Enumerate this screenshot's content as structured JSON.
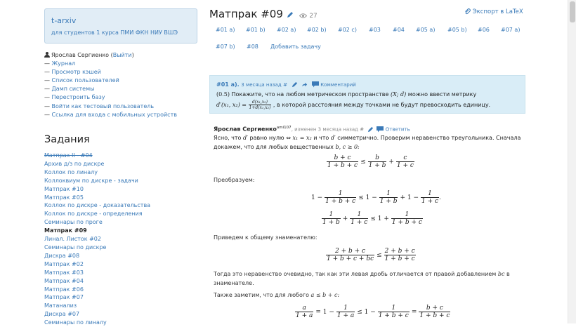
{
  "brand": {
    "title": "t-arxiv",
    "subtitle": "для студентов 1 курса ПМИ ФКН НИУ ВШЭ"
  },
  "user": {
    "name": "Ярослав Сергиенко",
    "logout_prefix": " (",
    "logout": "Выйти",
    "logout_suffix": ")"
  },
  "user_links": [
    "Журнал",
    "Просмотр кэшей",
    "Список пользователей",
    "Дамп системы",
    "Перестроить базу",
    "Войти как тестовый пользователь",
    "Ссылка для входа с мобильных устройств"
  ],
  "tasks_heading": "Задания",
  "tasks": [
    "Матпрак II - #04",
    "Архив д/з по дискре",
    "Коллок по линалу",
    "Коллоквиум по дискре - задачи",
    "Матпрак #10",
    "Матпрак #05",
    "Коллок по дискре - доказательства",
    "Коллок по дискре - определения",
    "Семинары по проге",
    "Матпрак #09",
    "Линал. Листок #02",
    "Семинары по дискре",
    "Дискра #08",
    "Матпрак #02",
    "Матпрак #03",
    "Матпрак #04",
    "Матпрак #06",
    "Матпрак #07",
    "Матанализ",
    "Дискра #07",
    "Семинары по линалу"
  ],
  "page": {
    "title": "Матпрак #09",
    "views": "27",
    "export": "Экспорт в LaTeX"
  },
  "subnav": [
    "#01 a)",
    "#01 b)",
    "#02 a)",
    "#02 b)",
    "#02 c)",
    "#03",
    "#04",
    "#05 a)",
    "#05 b)",
    "#06",
    "#07 a)",
    "#07 b)",
    "#08",
    "Добавить задачу"
  ],
  "problem": {
    "label": "#01 a).",
    "when": "3 месяца назад",
    "hash": "#",
    "comment": "Комментарий",
    "points": "(0.5)",
    "text1": "Покажите, что на любом метрическом пространстве",
    "space": "(X; d)",
    "text2": "можно ввести метрику",
    "metric_lhs": "d′(x₁, x₂) =",
    "metric_num": "d(x₁,x₂)",
    "metric_den": "1+d(x₁,x₂)",
    "text3": ", в которой расстояния между точками не будут превосходить единицу."
  },
  "solution": {
    "author": "Ярослав Сергиенко",
    "author_sup": "ami107",
    "edited": ", изменен 3 месяца назад #",
    "reply": "Ответить",
    "p1a": "Ясно, что",
    "p1b": "равно нулю ⇔",
    "p1c": "и что",
    "p1d": "симметрично. Проверим неравенство треугольника. Сначала",
    "p1e": "докажем, что для любых вещественных",
    "p2": "Преобразуем:",
    "p3": "Приведем к общему знаменателю:",
    "p4a": "Тогда это неравенство очевидно, так как эти левая дробь отличается от правой добавлением",
    "p4b": "в",
    "p4c": "знаменателе.",
    "p5": "Также заметим, что для любого"
  },
  "math": {
    "dprime": "d′",
    "x1eqx2": "x₁ = x₂",
    "bc_ge0": "b, c ≥ 0:",
    "bc": "bc",
    "a_le": "a ≤ b + c:",
    "f1": [
      "b + c",
      "1 + b + c",
      "≤",
      "b",
      "1 + b",
      "+",
      "c",
      "1 + c"
    ],
    "f2": [
      "1 −",
      "1",
      "1 + b + c",
      "≤ 1 −",
      "1",
      "1 + b",
      "+ 1 −",
      "1",
      "1 + c",
      "."
    ],
    "f3": [
      "1",
      "1 + b",
      "+",
      "1",
      "1 + c",
      "≤ 1 +",
      "1",
      "1 + b + c"
    ],
    "f4": [
      "2 + b + c",
      "1 + b + c + bc",
      "≤",
      "2 + b + c",
      "1 + b + c"
    ],
    "f5": [
      "a",
      "1 + a",
      "= 1 −",
      "1",
      "1 + a",
      "≤ 1 −",
      "1",
      "1 + b + c",
      "=",
      "b + c",
      "1 + b + c"
    ]
  }
}
